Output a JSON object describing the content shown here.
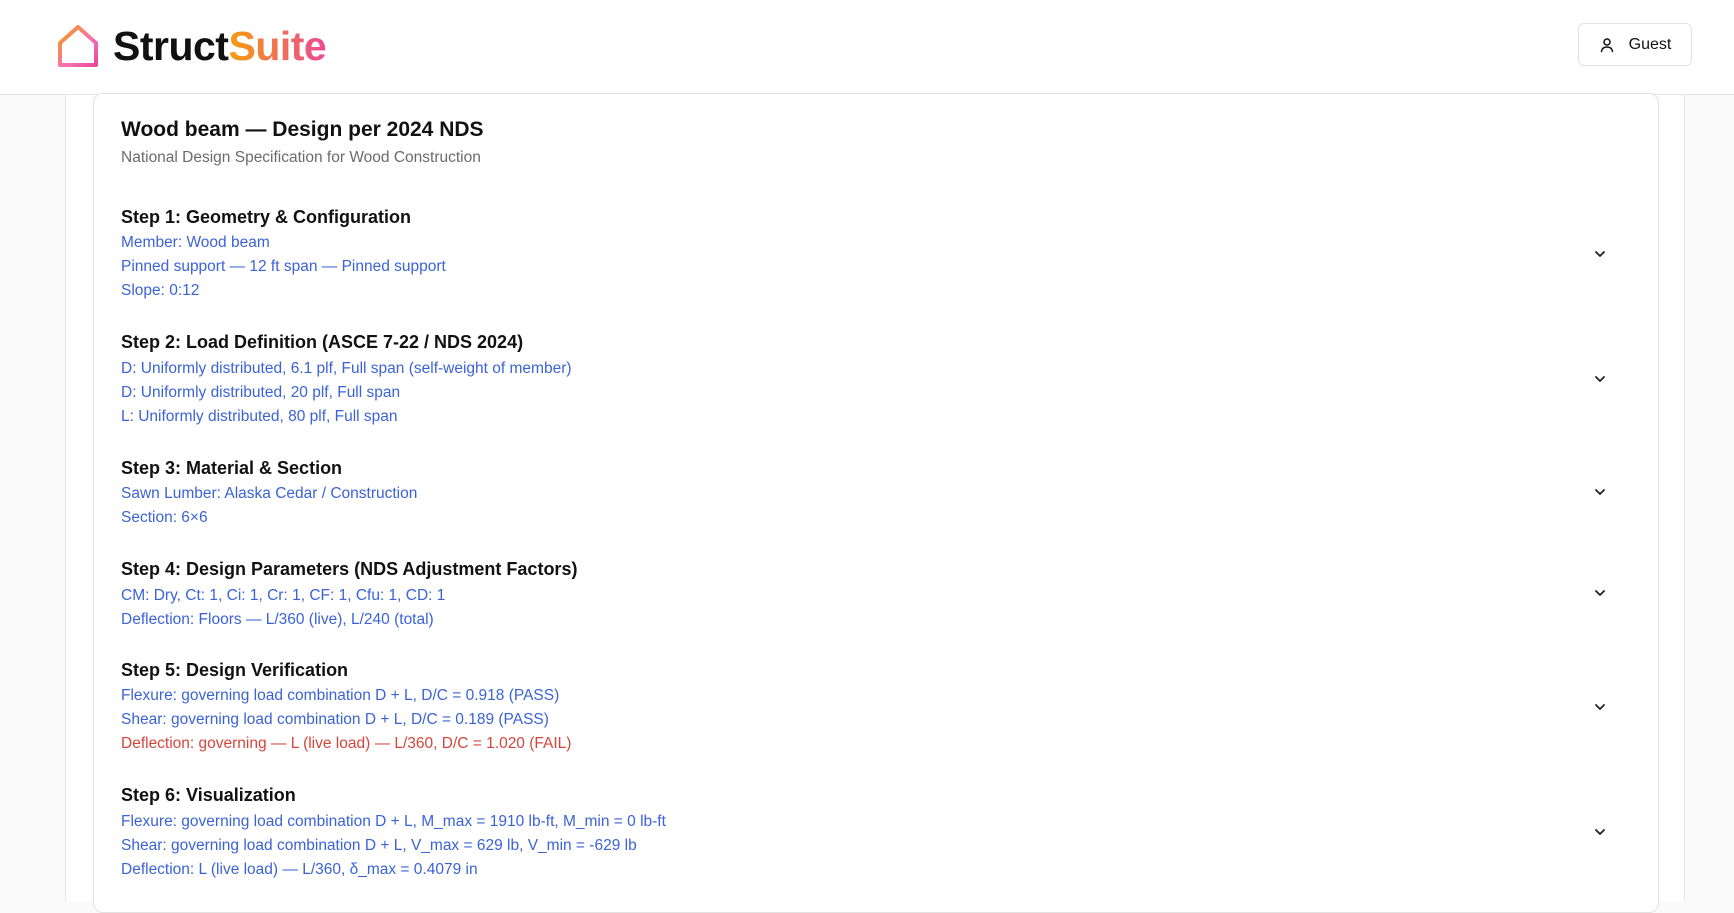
{
  "header": {
    "brand_part1": "Struct",
    "brand_part2": "Suite",
    "user_label": "Guest"
  },
  "card": {
    "title": "Wood beam — Design per 2024 NDS",
    "subtitle": "National Design Specification for Wood Construction"
  },
  "steps": [
    {
      "title": "Step 1: Geometry & Configuration",
      "lines": [
        "Member: Wood beam",
        "Pinned support — 12 ft span — Pinned support",
        "Slope: 0:12"
      ]
    },
    {
      "title": "Step 2: Load Definition (ASCE 7-22 / NDS 2024)",
      "lines": [
        "D: Uniformly distributed, 6.1 plf, Full span (self-weight of member)",
        "D: Uniformly distributed, 20 plf, Full span",
        "L: Uniformly distributed, 80 plf, Full span"
      ]
    },
    {
      "title": "Step 3: Material & Section",
      "lines": [
        "Sawn Lumber: Alaska Cedar / Construction",
        "Section: 6×6"
      ]
    },
    {
      "title": "Step 4: Design Parameters (NDS Adjustment Factors)",
      "lines": [
        "CM: Dry, Ct: 1, Ci: 1, Cr: 1, CF: 1, Cfu: 1, CD: 1",
        "Deflection: Floors — L/360 (live), L/240 (total)"
      ]
    },
    {
      "title": "Step 5: Design Verification",
      "lines": [
        "Flexure: governing load combination D + L, D/C = 0.918 (PASS)",
        "Shear: governing load combination D + L, D/C = 0.189 (PASS)",
        "Deflection: governing — L (live load) — L/360, D/C = 1.020 (FAIL)"
      ]
    },
    {
      "title": "Step 6: Visualization",
      "lines": [
        "Flexure: governing load combination D + L, M_max = 1910 lb-ft, M_min = 0 lb-ft",
        "Shear: governing load combination D + L, V_max = 629 lb, V_min = -629 lb",
        "Deflection: L (live load) — L/360, δ_max = 0.4079 in"
      ]
    }
  ],
  "colors": {
    "link_blue": "#3b63d6",
    "fail_red": "#d6453b",
    "brand_gradient_start": "#f59e0b",
    "brand_gradient_end": "#ec4899"
  },
  "icons": {
    "logo": "house-outline-icon",
    "user": "user-icon",
    "expand": "chevron-down-icon"
  }
}
